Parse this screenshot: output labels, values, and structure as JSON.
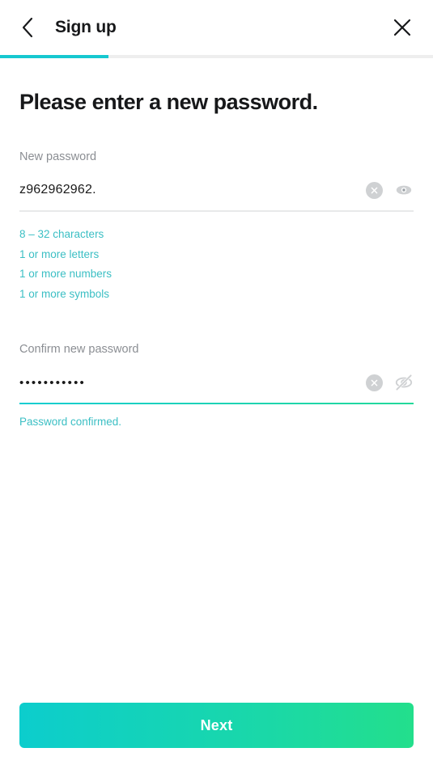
{
  "header": {
    "title": "Sign up",
    "back_icon": "chevron-left-icon",
    "close_icon": "close-icon"
  },
  "progress": {
    "percent": 25,
    "fill_color": "#16c8d0",
    "track_color": "#eeeeee"
  },
  "main": {
    "heading": "Please enter a new password.",
    "new_password": {
      "label": "New password",
      "value": "z962962962.",
      "visible": true,
      "clear_icon": "clear-circle-icon",
      "toggle_icon": "eye-icon",
      "underline_state": "inactive"
    },
    "rules": [
      "8 – 32 characters",
      "1 or more letters",
      "1 or more numbers",
      "1 or more symbols"
    ],
    "confirm_password": {
      "label": "Confirm new password",
      "value": "•••••••••••",
      "visible": false,
      "clear_icon": "clear-circle-icon",
      "toggle_icon": "eye-off-icon",
      "underline_state": "active",
      "message": "Password confirmed."
    }
  },
  "footer": {
    "next_label": "Next"
  },
  "colors": {
    "accent_teal": "#3bbfc4",
    "accent_cyan": "#0ccdcd",
    "accent_green": "#23df8c",
    "label_gray": "#8b8e93",
    "text_dark": "#17181a"
  }
}
